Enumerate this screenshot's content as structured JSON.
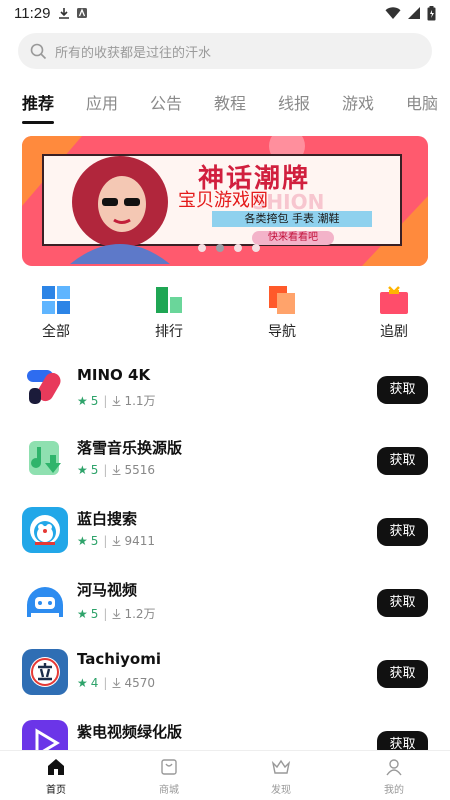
{
  "status": {
    "time": "11:29"
  },
  "search": {
    "placeholder": "所有的收获都是过往的汗水"
  },
  "tabs": [
    {
      "label": "推荐",
      "active": true
    },
    {
      "label": "应用"
    },
    {
      "label": "公告"
    },
    {
      "label": "教程"
    },
    {
      "label": "线报"
    },
    {
      "label": "游戏"
    },
    {
      "label": "电脑"
    }
  ],
  "banner": {
    "headline": "神话潮牌",
    "ghost_text": "SHION",
    "watermark": "宝贝游戏网",
    "subtitle": "各类挎包 手表 潮鞋",
    "cta": "快来看看吧",
    "active_slide": 2,
    "slide_count": 4
  },
  "categories": [
    {
      "label": "全部",
      "icon": "grid-icon"
    },
    {
      "label": "排行",
      "icon": "ranking-icon"
    },
    {
      "label": "导航",
      "icon": "navigation-icon"
    },
    {
      "label": "追剧",
      "icon": "tv-icon"
    }
  ],
  "apps": [
    {
      "name": "MINO 4K",
      "rating": "5",
      "downloads": "1.1万",
      "button": "获取"
    },
    {
      "name": "落雪音乐换源版",
      "rating": "5",
      "downloads": "5516",
      "button": "获取"
    },
    {
      "name": "蓝白搜索",
      "rating": "5",
      "downloads": "9411",
      "button": "获取"
    },
    {
      "name": "河马视频",
      "rating": "5",
      "downloads": "1.2万",
      "button": "获取"
    },
    {
      "name": "Tachiyomi",
      "rating": "4",
      "downloads": "4570",
      "button": "获取"
    },
    {
      "name": "紫电视频绿化版",
      "rating": "",
      "downloads": "",
      "button": "获取"
    }
  ],
  "bottom_nav": [
    {
      "label": "首页",
      "active": true
    },
    {
      "label": "商城"
    },
    {
      "label": "发现"
    },
    {
      "label": "我的"
    }
  ],
  "colors": {
    "accent_green": "#2ea36a",
    "banner_bg": "#ff5a6e",
    "button_bg": "#111111"
  }
}
